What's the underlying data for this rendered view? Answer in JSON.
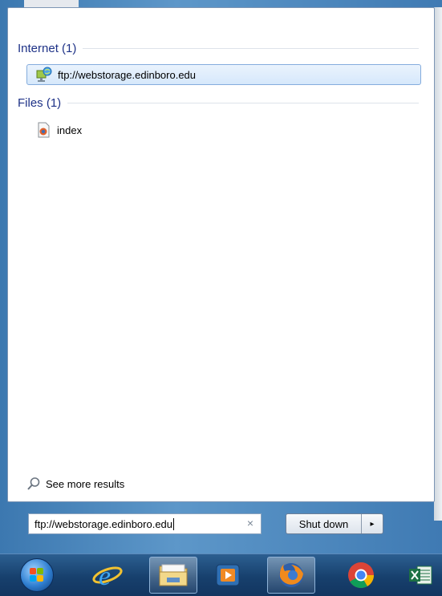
{
  "groups": {
    "internet": {
      "title": "Internet (1)",
      "items": [
        {
          "label": "ftp://webstorage.edinboro.edu",
          "icon": "network-location-icon",
          "selected": true
        }
      ]
    },
    "files": {
      "title": "Files (1)",
      "items": [
        {
          "label": "index",
          "icon": "html-file-icon",
          "selected": false
        }
      ]
    }
  },
  "see_more": {
    "label": "See more results",
    "icon": "search-icon"
  },
  "search": {
    "value": "ftp://webstorage.edinboro.edu",
    "clear_glyph": "×",
    "clear_icon": "close-icon"
  },
  "shutdown": {
    "label": "Shut down",
    "arrow_glyph": "▸"
  },
  "taskbar": {
    "items": [
      {
        "name": "start-orb",
        "icon": "windows-start-icon"
      },
      {
        "name": "internet-explorer",
        "icon": "internet-explorer-icon"
      },
      {
        "name": "file-explorer",
        "icon": "folder-icon"
      },
      {
        "name": "media-player",
        "icon": "media-player-icon"
      },
      {
        "name": "firefox",
        "icon": "firefox-icon",
        "active": true
      },
      {
        "name": "chrome",
        "icon": "chrome-icon"
      },
      {
        "name": "excel",
        "icon": "excel-icon"
      }
    ]
  },
  "colors": {
    "group_title": "#1e3287",
    "selection_fill": "#d6e8fb",
    "selection_border": "#84acdd",
    "taskbar": "#17406d"
  }
}
